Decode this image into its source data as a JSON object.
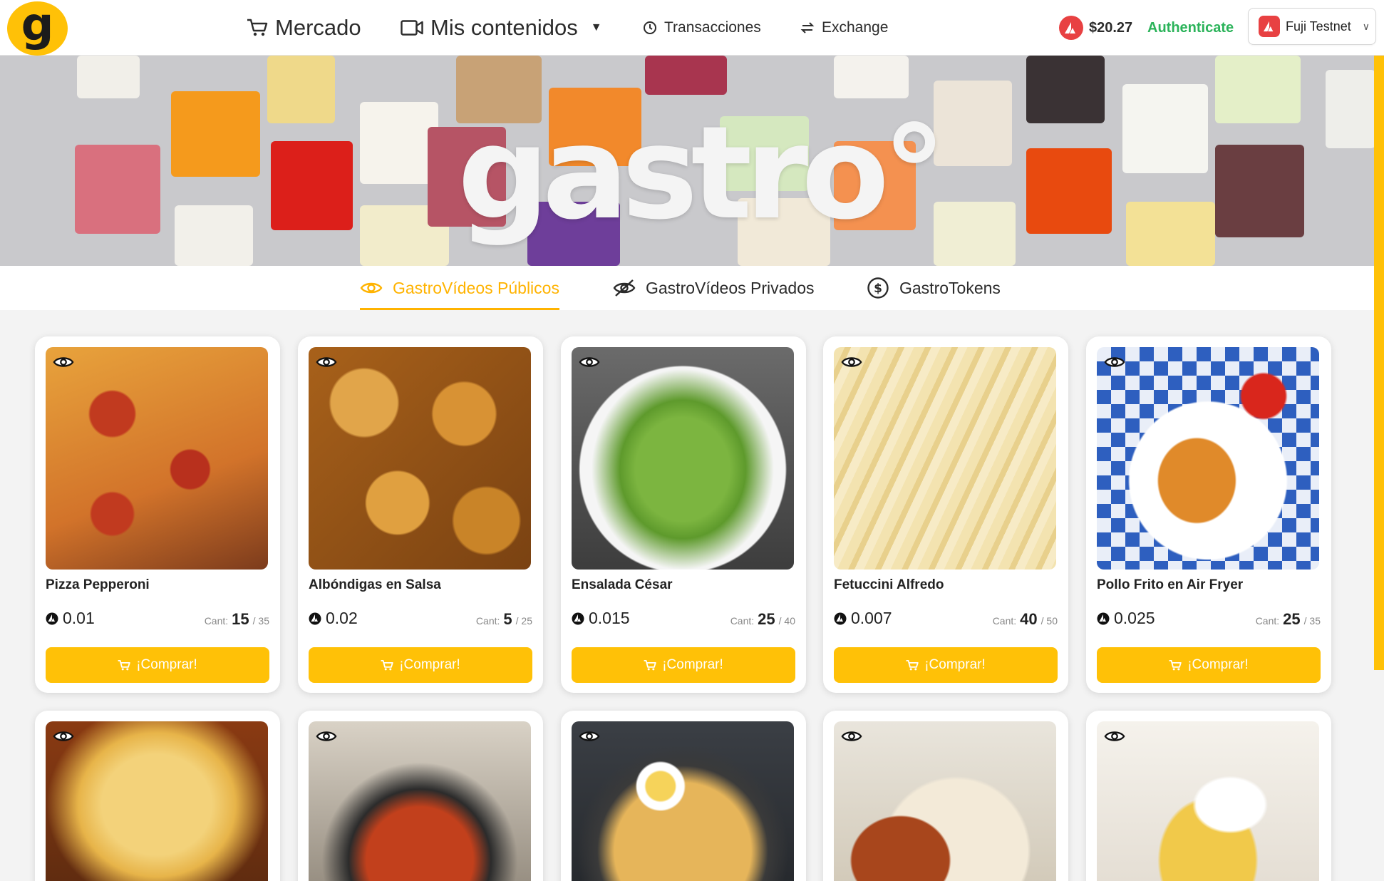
{
  "logo": {
    "letter": "g"
  },
  "nav": {
    "market": "Mercado",
    "contents": "Mis contenidos",
    "transactions": "Transacciones",
    "exchange": "Exchange"
  },
  "account": {
    "balance": "$20.27",
    "authenticate": "Authenticate",
    "network": "Fuji Testnet"
  },
  "hero": {
    "brand": "gastro°"
  },
  "tabs": [
    {
      "label": "GastroVídeos Públicos",
      "active": true
    },
    {
      "label": "GastroVídeos Privados",
      "active": false
    },
    {
      "label": "GastroTokens",
      "active": false
    }
  ],
  "products": [
    {
      "name": "Pizza Pepperoni",
      "price": "0.01",
      "count": "15",
      "total": "/ 35"
    },
    {
      "name": "Albóndigas en Salsa",
      "price": "0.02",
      "count": "5",
      "total": "/ 25"
    },
    {
      "name": "Ensalada César",
      "price": "0.015",
      "count": "25",
      "total": "/ 40"
    },
    {
      "name": "Fetuccini Alfredo",
      "price": "0.007",
      "count": "40",
      "total": "/ 50"
    },
    {
      "name": "Pollo Frito en Air Fryer",
      "price": "0.025",
      "count": "25",
      "total": "/ 35"
    }
  ],
  "labels": {
    "cant": "Cant:",
    "buy": "¡Comprar!"
  },
  "colors": {
    "accent": "#ffc107",
    "auth": "#2bb35a",
    "avax": "#e84142"
  }
}
